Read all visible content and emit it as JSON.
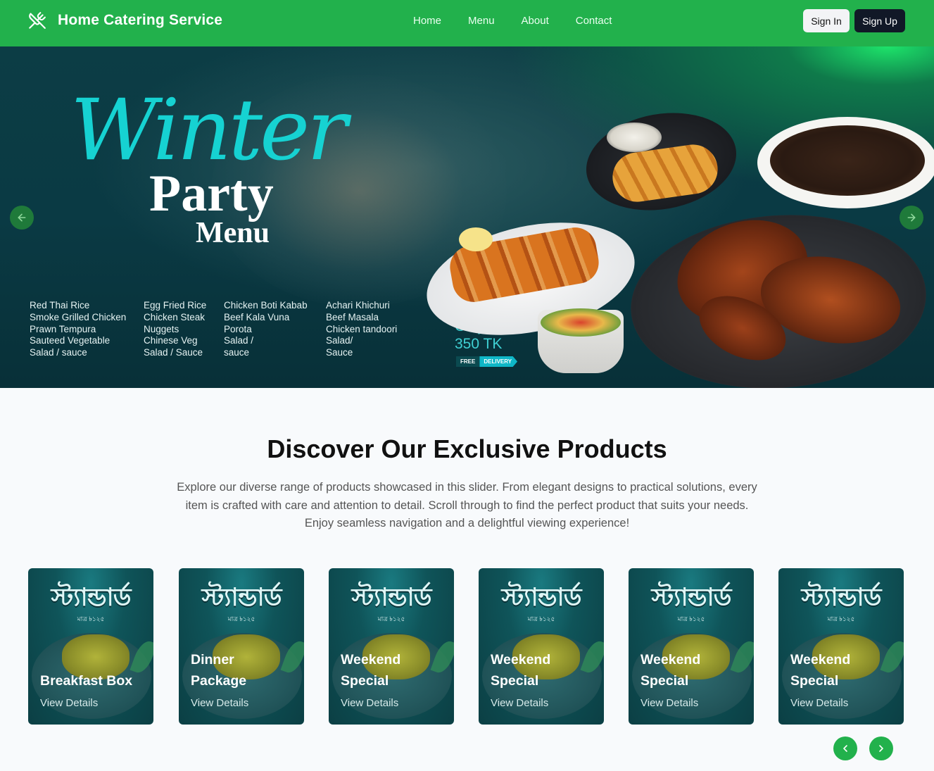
{
  "nav": {
    "brand": "Home Catering Service",
    "brand_icon": "utensils-crossed-icon",
    "links": [
      "Home",
      "Menu",
      "About",
      "Contact"
    ],
    "sign_in": "Sign In",
    "sign_up": "Sign Up",
    "colors": {
      "bar": "#22b14c",
      "sign_up_bg": "#111827"
    }
  },
  "hero": {
    "script_title": "Winter",
    "title": "Party",
    "subtitle": "Menu",
    "menu_columns": [
      [
        "Red Thai Rice",
        "Smoke Grilled Chicken",
        "Prawn Tempura",
        "Sauteed Vegetable",
        "Salad / sauce"
      ],
      [
        "Egg Fried Rice",
        "Chicken Steak",
        "Nuggets",
        "Chinese Veg",
        "Salad / Sauce"
      ],
      [
        "Chicken Boti Kabab",
        "Beef Kala Vuna",
        "Porota",
        "Salad /",
        "sauce"
      ],
      [
        "Achari Khichuri",
        "Beef Masala",
        "Chicken tandoori",
        "Salad/",
        "Sauce"
      ]
    ],
    "price_label": "Only",
    "price": "350 TK",
    "badge_free": "FREE",
    "badge_delivery": "DELIVERY",
    "prev_icon": "arrow-left-icon",
    "next_icon": "arrow-right-icon"
  },
  "discover": {
    "title": "Discover Our Exclusive Products",
    "description": "Explore our diverse range of products showcased in this slider. From elegant designs to practical solutions, every item is crafted with care and attention to detail. Scroll through to find the perfect product that suits your needs. Enjoy seamless navigation and a delightful viewing experience!"
  },
  "products": [
    {
      "brand": "স্ট্যান্ডার্ড",
      "sub": "মাত্র ৳১২৫",
      "name": [
        "Breakfast Box"
      ],
      "link": "View Details"
    },
    {
      "brand": "স্ট্যান্ডার্ড",
      "sub": "মাত্র ৳১২৫",
      "name": [
        "Dinner",
        "Package"
      ],
      "link": "View Details"
    },
    {
      "brand": "স্ট্যান্ডার্ড",
      "sub": "মাত্র ৳১২৫",
      "name": [
        "Weekend",
        "Special"
      ],
      "link": "View Details"
    },
    {
      "brand": "স্ট্যান্ডার্ড",
      "sub": "মাত্র ৳১২৫",
      "name": [
        "Weekend",
        "Special"
      ],
      "link": "View Details"
    },
    {
      "brand": "স্ট্যান্ডার্ড",
      "sub": "মাত্র ৳১২৫",
      "name": [
        "Weekend",
        "Special"
      ],
      "link": "View Details"
    },
    {
      "brand": "স্ট্যান্ডার্ড",
      "sub": "মাত্র ৳১২৫",
      "name": [
        "Weekend",
        "Special"
      ],
      "link": "View Details"
    }
  ],
  "carousel": {
    "prev_icon": "chevron-left-icon",
    "next_icon": "chevron-right-icon"
  }
}
